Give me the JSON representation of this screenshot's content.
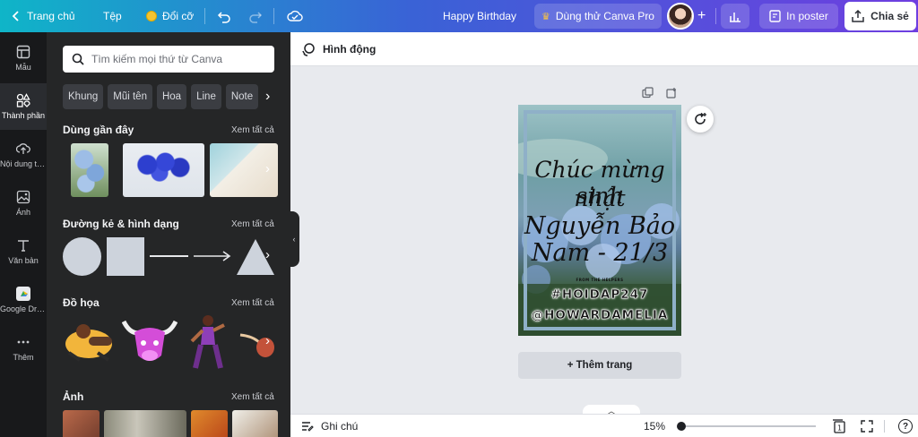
{
  "topbar": {
    "back_label": "Trang chủ",
    "file_label": "Tệp",
    "resize_label": "Đổi cỡ",
    "doc_title": "Happy Birthday",
    "pro_label": "Dùng thử Canva Pro",
    "print_label": "In poster",
    "share_label": "Chia sẻ"
  },
  "rail": [
    {
      "label": "Mẫu",
      "icon": "template-icon"
    },
    {
      "label": "Thành phần",
      "icon": "elements-icon"
    },
    {
      "label": "Nội dung tải lên",
      "icon": "upload-icon"
    },
    {
      "label": "Ảnh",
      "icon": "photo-icon"
    },
    {
      "label": "Văn bản",
      "icon": "text-icon"
    },
    {
      "label": "Google Drive",
      "icon": "google-drive-icon"
    },
    {
      "label": "Thêm",
      "icon": "more-icon"
    }
  ],
  "panel": {
    "search_placeholder": "Tìm kiếm mọi thứ từ Canva",
    "chips": [
      "Khung",
      "Mũi tên",
      "Hoa",
      "Line",
      "Note"
    ],
    "sections": [
      {
        "title": "Dùng gần đây",
        "see_all": "Xem tất cả"
      },
      {
        "title": "Đường kẻ & hình dạng",
        "see_all": "Xem tất cả"
      },
      {
        "title": "Đồ họa",
        "see_all": "Xem tất cả"
      },
      {
        "title": "Ảnh",
        "see_all": "Xem tất cả"
      }
    ]
  },
  "subbar": {
    "animate_label": "Hình động"
  },
  "poster": {
    "line1": "Chúc mừng sinh",
    "line2": "nhật",
    "line3": "Nguyễn Bảo",
    "line4": "Nam - 21/3",
    "small": "FROM THE HELPERS",
    "tag1": "#HOIDAP247",
    "tag2": "@HOWARDAMELIA"
  },
  "canvas": {
    "add_page_label": "+ Thêm trang"
  },
  "bottombar": {
    "notes_label": "Ghi chú",
    "zoom": "15%",
    "zoom_fraction": 0.0,
    "page_count": "1",
    "help_label": "?"
  },
  "colors": {
    "topbar_start": "#0fb5c8",
    "topbar_end": "#6e3ee0",
    "rail_bg": "#18191b",
    "panel_bg": "#252627",
    "canvas_bg": "#e8eaee"
  }
}
